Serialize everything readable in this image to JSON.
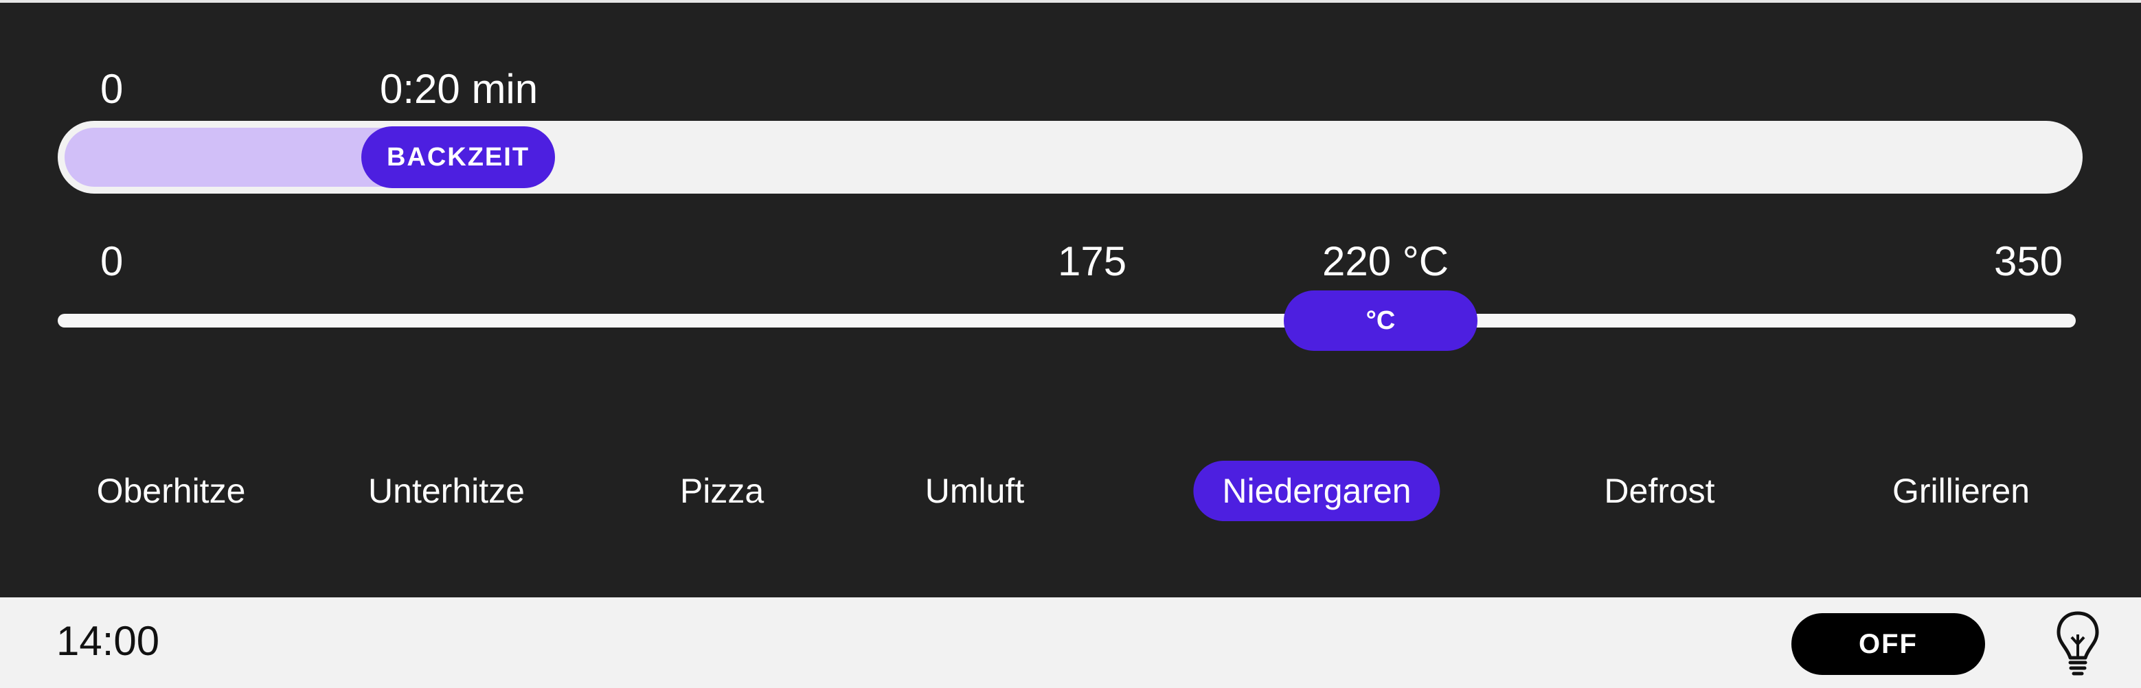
{
  "timer": {
    "min_label": "0",
    "current_label": "0:20 min",
    "thumb_label": "BACKZEIT"
  },
  "temperature": {
    "min_label": "0",
    "mid_label": "175",
    "current_label": "220 °C",
    "max_label": "350",
    "thumb_label": "°C",
    "min": 0,
    "max": 350,
    "value": 220
  },
  "modes": [
    {
      "label": "Oberhitze",
      "selected": false
    },
    {
      "label": "Unterhitze",
      "selected": false
    },
    {
      "label": "Pizza",
      "selected": false
    },
    {
      "label": "Umluft",
      "selected": false
    },
    {
      "label": "Niedergaren",
      "selected": true
    },
    {
      "label": "Defrost",
      "selected": false
    },
    {
      "label": "Grillieren",
      "selected": false
    }
  ],
  "footer": {
    "clock": "14:00",
    "off_label": "OFF",
    "light_icon": "lightbulb-icon"
  },
  "colors": {
    "panel_bg": "#212121",
    "accent": "#4d1fe0",
    "timer_fill": "#d1bff8",
    "track": "#f2f2f2"
  }
}
